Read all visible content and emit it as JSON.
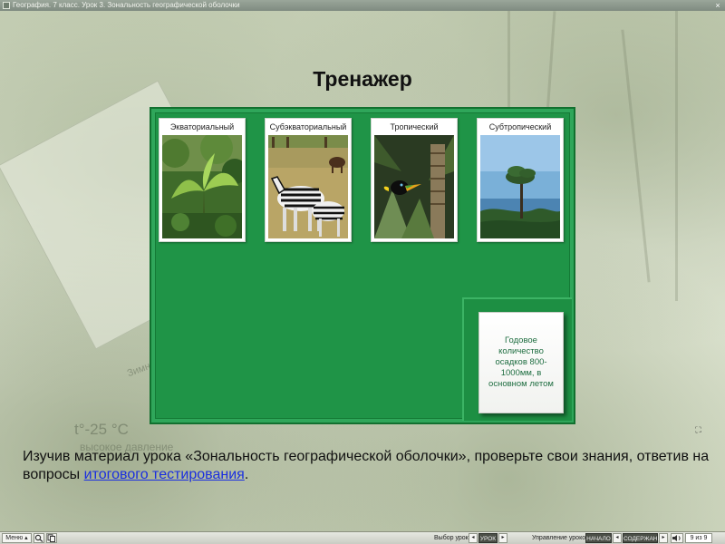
{
  "window": {
    "title": "География. 7 класс. Урок 3. Зональность географической оболочки",
    "close_glyph": "×"
  },
  "background_texts": {
    "temperature": "t°-25 °C",
    "note": "высокое давление",
    "zone_word": "Зимн"
  },
  "heading": "Тренажер",
  "board": {
    "colors": {
      "board": "#1f9447",
      "answer_text": "#1e6d40"
    },
    "cards": [
      {
        "label": "Экваториальный",
        "image": "equatorial-forest"
      },
      {
        "label": "Субэкваториальный",
        "image": "savanna-zebras"
      },
      {
        "label": "Тропический",
        "image": "tropical-toucan"
      },
      {
        "label": "Субтропический",
        "image": "subtropical-pine"
      }
    ],
    "answer_card": "Годовое количество осадков 800-1000мм, в основном летом"
  },
  "instruction": {
    "text": "Изучив материал урока «Зональность географической оболочки», проверьте свои знания, ответив на вопросы ",
    "link": "итогового тестирования",
    "tail": "."
  },
  "toolbar": {
    "menu": "Меню ▴",
    "lesson_select_label": "Выбор урока:",
    "lesson_prev": "◂",
    "lesson_value": "УРОК",
    "lesson_next": "▸",
    "lesson_control_label": "Управление уроком:",
    "start": "НАЧАЛО",
    "contents_prev": "◂",
    "contents": "СОДЕРЖАНИЕ",
    "contents_next": "▸",
    "page_indicator": "9 из 9"
  }
}
